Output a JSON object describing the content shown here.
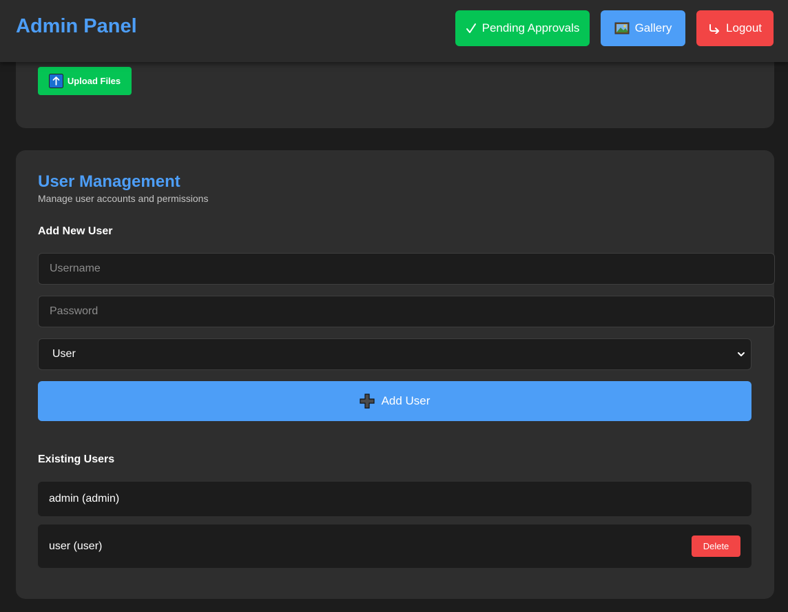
{
  "header": {
    "title": "Admin Panel",
    "pending_label": "Pending Approvals",
    "gallery_label": "Gallery",
    "logout_label": "Logout"
  },
  "upload": {
    "label": "Upload Files"
  },
  "user_management": {
    "title": "User Management",
    "subtitle": "Manage user accounts and permissions",
    "add_heading": "Add New User",
    "username_placeholder": "Username",
    "password_placeholder": "Password",
    "role_selected": "User",
    "add_button_label": "Add User",
    "existing_heading": "Existing Users",
    "users": [
      {
        "label": "admin (admin)"
      },
      {
        "label": "user (user)",
        "delete_label": "Delete"
      }
    ]
  },
  "colors": {
    "accent_blue": "#4d9ef7",
    "success_green": "#05c454",
    "danger_red": "#f24545",
    "background": "#1c1c1c",
    "card": "#2e2e2e"
  },
  "icons": {
    "pending": "check-icon",
    "gallery": "picture-icon",
    "logout": "logout-arrow-icon",
    "upload": "upload-arrow-icon",
    "add": "plus-icon",
    "select": "chevron-down-icon"
  }
}
